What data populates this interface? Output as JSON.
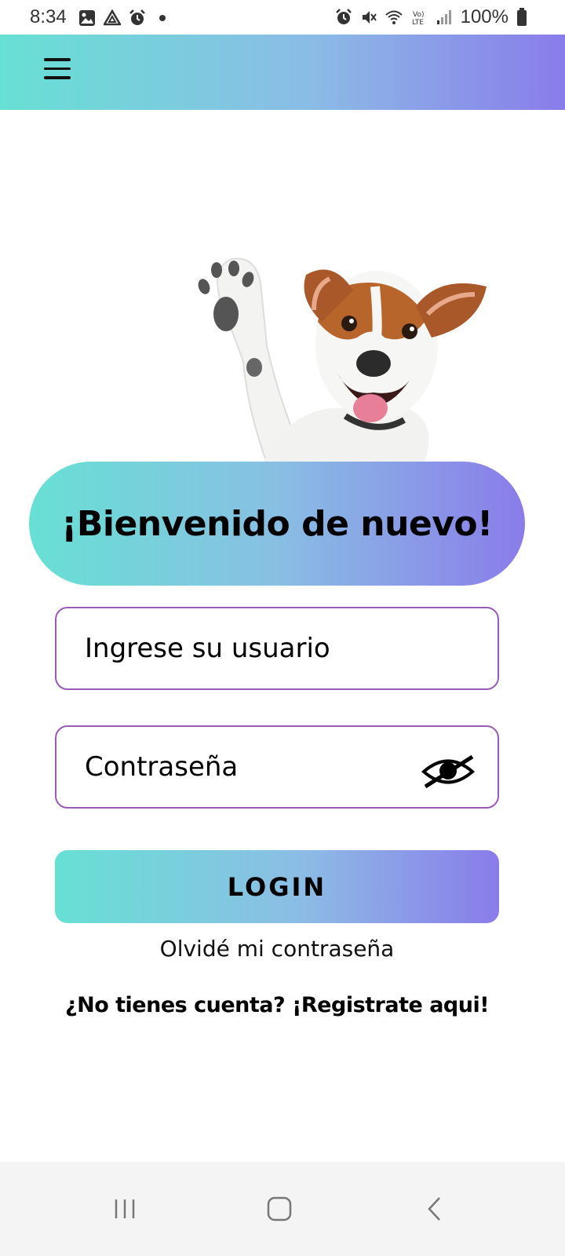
{
  "status_bar": {
    "time": "8:34",
    "battery": "100%",
    "left_icons": [
      "image-icon",
      "drive-icon",
      "alarm-icon",
      "dot-icon"
    ],
    "right_icons": [
      "alarm-icon",
      "mute-icon",
      "wifi-icon",
      "volte-icon",
      "signal-icon",
      "battery-icon"
    ]
  },
  "header": {
    "menu_icon": "hamburger-menu-icon",
    "gradient": [
      "#67e0d4",
      "#8a7cea"
    ]
  },
  "welcome": {
    "title": "¡Bienvenido de nuevo!"
  },
  "form": {
    "username_placeholder": "Ingrese su usuario",
    "password_placeholder": "Contraseña",
    "password_toggle_icon": "eye-slash-icon",
    "login_label": "LOGIN",
    "forgot_label": "Olvidé mi contraseña",
    "register_label": "¿No tienes cuenta? ¡Registrate aqui!"
  },
  "colors": {
    "accent_start": "#67e0d4",
    "accent_end": "#8a7cea",
    "input_border": "#9c5ab8"
  },
  "nav_bar": {
    "recents_icon": "recents-icon",
    "home_icon": "home-icon",
    "back_icon": "back-icon"
  }
}
